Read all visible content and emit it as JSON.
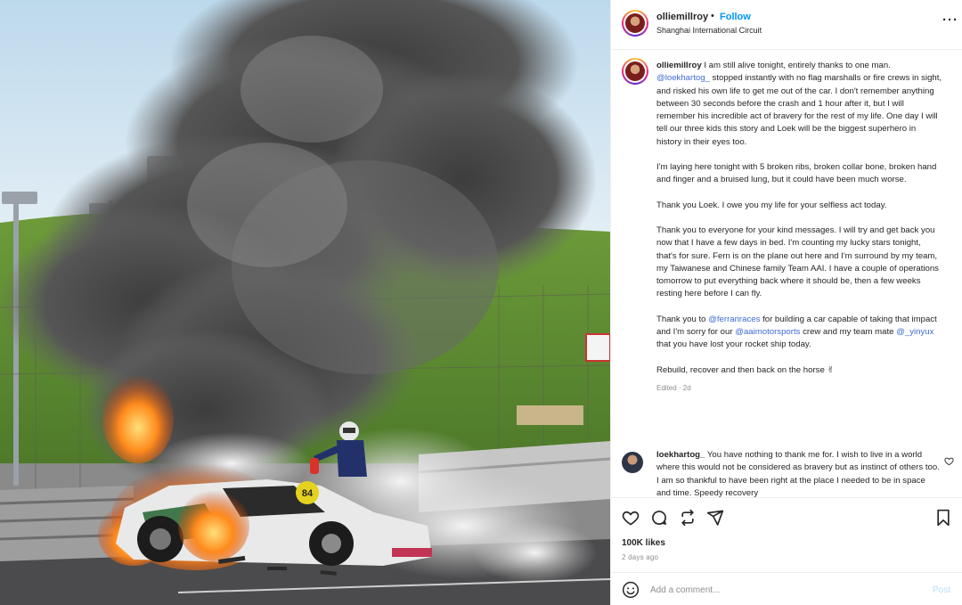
{
  "post": {
    "author": "olliemillroy",
    "separator": "•",
    "follow_label": "Follow",
    "location": "Shanghai International Circuit",
    "more_icon": "more-horizontal-icon",
    "photo_car_number": "84"
  },
  "caption": {
    "author": "olliemillroy",
    "p1_a": " I am still alive tonight, entirely thanks to one man. ",
    "p1_mention": "@loekhartog_",
    "p1_b": " stopped instantly with no flag marshalls or fire crews in sight, and risked his own life to get me out of the car. I don't remember anything between 30 seconds before the crash and 1 hour after it, but I will remember his incredible act of bravery for the rest of my life. One day I will tell our three kids this story and Loek will be the biggest superhero in history in their eyes too.",
    "p2": "I'm laying here tonight with 5 broken ribs, broken collar bone, broken hand and finger and a bruised lung, but it could have been much worse.",
    "p3": "Thank you Loek. I owe you my life for your selfless act today.",
    "p4": "Thank you to everyone for your kind messages. I will try and get back you now that I have a few days in bed. I'm counting my lucky stars tonight, that's for sure. Fern is on the plane out here and I'm surround by my team, my Taiwanese and Chinese family Team AAI. I have a couple of operations tomorrow to put everything back where it should be, then a few weeks resting here before I can fly.",
    "p5_a": "Thank you to ",
    "p5_m1": "@ferrariraces",
    "p5_b": " for building a car capable of taking that impact and I'm sorry for our ",
    "p5_m2": "@aaimotorsports",
    "p5_c": " crew and my team mate ",
    "p5_m3": "@_yinyux",
    "p5_d": " that you have lost your rocket ship today.",
    "p6": "Rebuild, recover and then back on the horse ✌",
    "edited": "Edited · 2d"
  },
  "comment": {
    "author": "loekhartog_",
    "text": " You have nothing to thank me for. I wish to live in a world where this would not be considered as bravery but as instinct of others too. I am so thankful to have been right at the place I needed to be in space and time. Speedy recovery"
  },
  "actions": {
    "like_icon": "heart-icon",
    "comment_icon": "comment-icon",
    "share_icon": "repost-icon",
    "send_icon": "send-icon",
    "save_icon": "bookmark-icon",
    "likes": "100K likes",
    "time_ago": "2 days ago"
  },
  "add_comment": {
    "placeholder": "Add a comment...",
    "post_label": "Post",
    "emoji_icon": "emoji-icon"
  },
  "colors": {
    "link": "#0095f6",
    "mention": "#3f6ad8",
    "muted": "#8e8e8e",
    "post_disabled": "#b2dffc"
  }
}
